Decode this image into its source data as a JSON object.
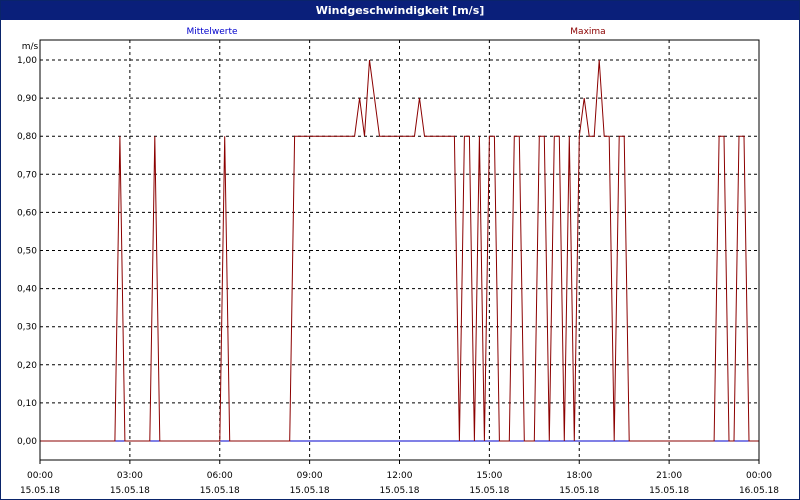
{
  "window": {
    "title": "Windgeschwindigkeit [m/s]"
  },
  "legend": {
    "mean_label": "Mittelwerte",
    "max_label": "Maxima",
    "mean_color": "#0000cc",
    "max_color": "#8b0000"
  },
  "chart_data": {
    "type": "line",
    "title": "Windgeschwindigkeit [m/s]",
    "ylabel": "m/s",
    "xlabel": "",
    "ylim": [
      0,
      1.0
    ],
    "xlim_hours": [
      0,
      24
    ],
    "grid": true,
    "y_ticks": [
      "0,00",
      "0,10",
      "0,20",
      "0,30",
      "0,40",
      "0,50",
      "0,60",
      "0,70",
      "0,80",
      "0,90",
      "1,00"
    ],
    "x_ticks": [
      {
        "time": "00:00",
        "date": "15.05.18"
      },
      {
        "time": "03:00",
        "date": "15.05.18"
      },
      {
        "time": "06:00",
        "date": "15.05.18"
      },
      {
        "time": "09:00",
        "date": "15.05.18"
      },
      {
        "time": "12:00",
        "date": "15.05.18"
      },
      {
        "time": "15:00",
        "date": "15.05.18"
      },
      {
        "time": "18:00",
        "date": "15.05.18"
      },
      {
        "time": "21:00",
        "date": "15.05.18"
      },
      {
        "time": "00:00",
        "date": "16.05.18"
      }
    ],
    "series": [
      {
        "name": "Mittelwerte",
        "color": "#0000cc",
        "x": [
          "00:00",
          "24:00"
        ],
        "values": [
          0.0,
          0.0
        ]
      },
      {
        "name": "Maxima",
        "color": "#8b0000",
        "x": [
          "00:00",
          "02:30",
          "02:40",
          "02:50",
          "03:00",
          "03:40",
          "03:50",
          "04:00",
          "06:00",
          "06:10",
          "06:20",
          "08:20",
          "08:30",
          "10:30",
          "10:40",
          "10:50",
          "11:00",
          "11:10",
          "11:20",
          "11:30",
          "12:30",
          "12:40",
          "12:50",
          "13:00",
          "13:10",
          "13:50",
          "14:00",
          "14:10",
          "14:20",
          "14:30",
          "14:40",
          "14:50",
          "15:00",
          "15:10",
          "15:20",
          "15:40",
          "15:50",
          "16:00",
          "16:10",
          "16:30",
          "16:40",
          "16:50",
          "17:00",
          "17:10",
          "17:20",
          "17:30",
          "17:40",
          "17:50",
          "18:00",
          "18:10",
          "18:20",
          "18:30",
          "18:40",
          "18:50",
          "19:00",
          "19:10",
          "19:20",
          "19:30",
          "19:40",
          "19:50",
          "20:00",
          "20:10",
          "20:20",
          "22:30",
          "22:40",
          "22:50",
          "23:00",
          "23:10",
          "23:20",
          "23:30",
          "23:40",
          "23:50",
          "24:00"
        ],
        "values": [
          0,
          0,
          0.8,
          0,
          0,
          0,
          0.8,
          0,
          0,
          0.8,
          0,
          0,
          0.8,
          0.8,
          0.9,
          0.8,
          1.0,
          0.9,
          0.8,
          0.8,
          0.8,
          0.9,
          0.8,
          0.8,
          0.8,
          0.8,
          0,
          0.8,
          0.8,
          0,
          0.8,
          0,
          0.8,
          0.8,
          0,
          0,
          0.8,
          0.8,
          0,
          0,
          0.8,
          0.8,
          0,
          0.8,
          0.8,
          0,
          0.8,
          0,
          0.8,
          0.9,
          0.8,
          0.8,
          1.0,
          0.8,
          0.8,
          0,
          0.8,
          0.8,
          0,
          0,
          0,
          0,
          0,
          0,
          0.8,
          0.8,
          0,
          0,
          0.8,
          0.8,
          0,
          0,
          0
        ]
      }
    ]
  }
}
